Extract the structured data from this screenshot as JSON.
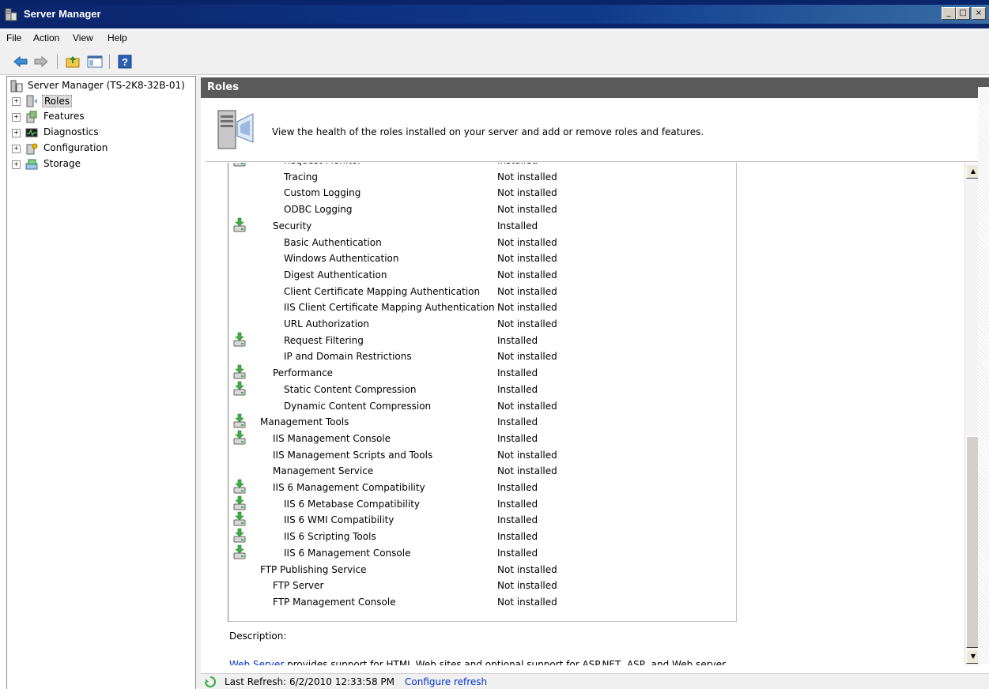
{
  "window": {
    "title": "Server Manager"
  },
  "window_buttons": [
    "_",
    "□",
    "×"
  ],
  "menu": [
    "File",
    "Action",
    "View",
    "Help"
  ],
  "nav": {
    "root": "Server Manager (TS-2K8-32B-01)",
    "items": [
      {
        "label": "Roles",
        "icon": "roles-icon",
        "selected": true
      },
      {
        "label": "Features",
        "icon": "features-icon"
      },
      {
        "label": "Diagnostics",
        "icon": "diagnostics-icon"
      },
      {
        "label": "Configuration",
        "icon": "configuration-icon"
      },
      {
        "label": "Storage",
        "icon": "storage-icon"
      }
    ]
  },
  "roles": {
    "title": "Roles",
    "header_text": "View the health of the roles installed on your server and add or remove roles and features."
  },
  "services": [
    {
      "name": "Request Monitor",
      "status": "Installed",
      "level": 2,
      "installed": true
    },
    {
      "name": "Tracing",
      "status": "Not installed",
      "level": 2,
      "installed": false
    },
    {
      "name": "Custom Logging",
      "status": "Not installed",
      "level": 2,
      "installed": false
    },
    {
      "name": "ODBC Logging",
      "status": "Not installed",
      "level": 2,
      "installed": false
    },
    {
      "name": "Security",
      "status": "Installed",
      "level": 1,
      "installed": true
    },
    {
      "name": "Basic Authentication",
      "status": "Not installed",
      "level": 2,
      "installed": false
    },
    {
      "name": "Windows Authentication",
      "status": "Not installed",
      "level": 2,
      "installed": false
    },
    {
      "name": "Digest Authentication",
      "status": "Not installed",
      "level": 2,
      "installed": false
    },
    {
      "name": "Client Certificate Mapping Authentication",
      "status": "Not installed",
      "level": 2,
      "installed": false
    },
    {
      "name": "IIS Client Certificate Mapping Authentication",
      "status": "Not installed",
      "level": 2,
      "installed": false
    },
    {
      "name": "URL Authorization",
      "status": "Not installed",
      "level": 2,
      "installed": false
    },
    {
      "name": "Request Filtering",
      "status": "Installed",
      "level": 2,
      "installed": true
    },
    {
      "name": "IP and Domain Restrictions",
      "status": "Not installed",
      "level": 2,
      "installed": false
    },
    {
      "name": "Performance",
      "status": "Installed",
      "level": 1,
      "installed": true
    },
    {
      "name": "Static Content Compression",
      "status": "Installed",
      "level": 2,
      "installed": true
    },
    {
      "name": "Dynamic Content Compression",
      "status": "Not installed",
      "level": 2,
      "installed": false
    },
    {
      "name": "Management Tools",
      "status": "Installed",
      "level": 0,
      "installed": true
    },
    {
      "name": "IIS Management Console",
      "status": "Installed",
      "level": 1,
      "installed": true
    },
    {
      "name": "IIS Management Scripts and Tools",
      "status": "Not installed",
      "level": 1,
      "installed": false
    },
    {
      "name": "Management Service",
      "status": "Not installed",
      "level": 1,
      "installed": false
    },
    {
      "name": "IIS 6 Management Compatibility",
      "status": "Installed",
      "level": 1,
      "installed": true
    },
    {
      "name": "IIS 6 Metabase Compatibility",
      "status": "Installed",
      "level": 2,
      "installed": true
    },
    {
      "name": "IIS 6 WMI Compatibility",
      "status": "Installed",
      "level": 2,
      "installed": true
    },
    {
      "name": "IIS 6 Scripting Tools",
      "status": "Installed",
      "level": 2,
      "installed": true
    },
    {
      "name": "IIS 6 Management Console",
      "status": "Installed",
      "level": 2,
      "installed": true
    },
    {
      "name": "FTP Publishing Service",
      "status": "Not installed",
      "level": 0,
      "installed": false
    },
    {
      "name": "FTP Server",
      "status": "Not installed",
      "level": 1,
      "installed": false
    },
    {
      "name": "FTP Management Console",
      "status": "Not installed",
      "level": 1,
      "installed": false
    }
  ],
  "description": {
    "label": "Description:",
    "link": "Web Server",
    "text": " provides support for HTML Web sites and optional support for ASP.NET, ASP, and Web server extensions. You can use the Web Server to host an internal or external Web site or to provide an"
  },
  "status": {
    "last_refresh": "Last Refresh: 6/2/2010 12:33:58 PM",
    "configure_link": "Configure refresh"
  },
  "scrollbar": {
    "up_arrow": "▲",
    "down_arrow": "▼"
  },
  "colors": {
    "installed_icon": "#3cb043",
    "link": "#0033cc",
    "roles_bar": "#5a5a5a",
    "titlebar": "#0a246a"
  }
}
